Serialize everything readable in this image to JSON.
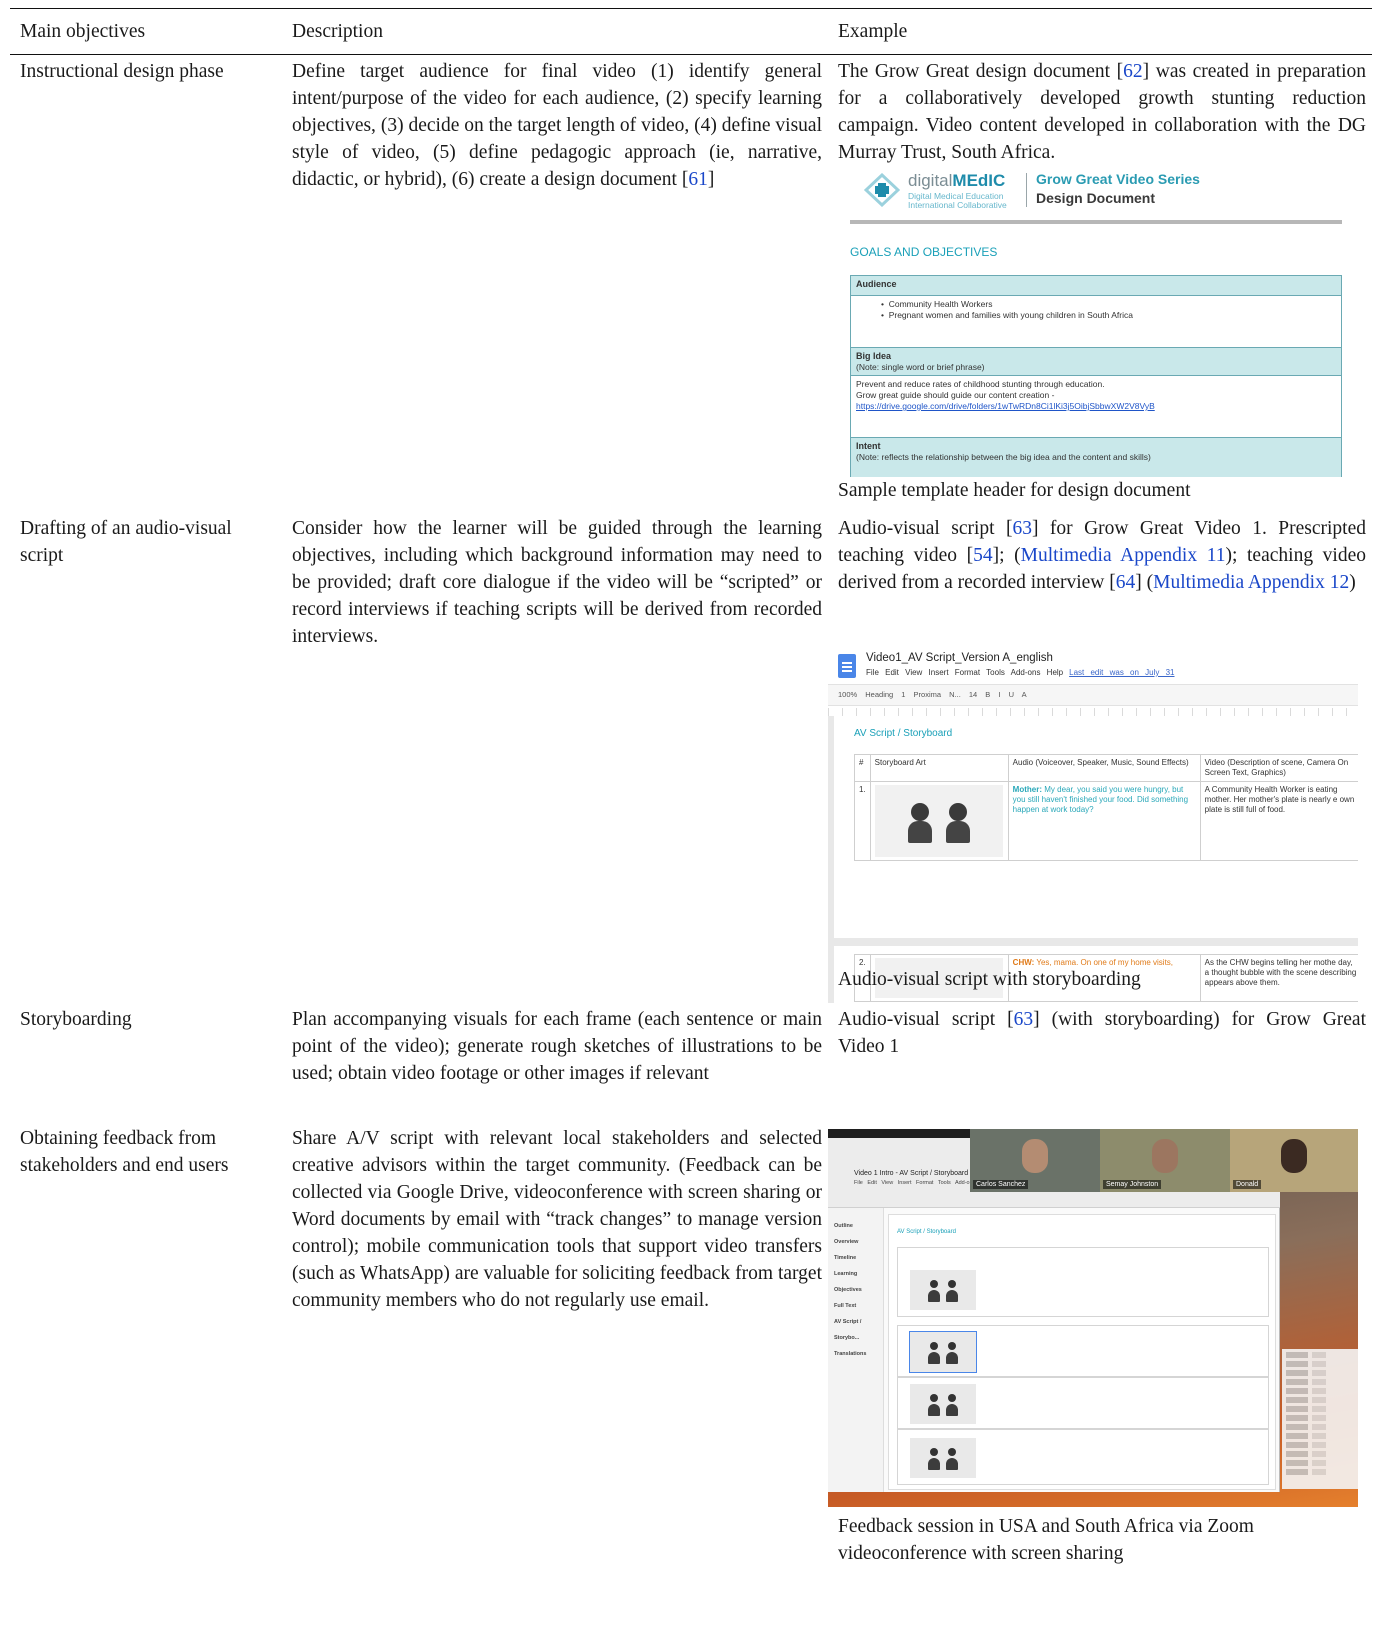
{
  "headers": {
    "col1": "Main objectives",
    "col2": "Description",
    "col3": "Example"
  },
  "rows": [
    {
      "objective": "Instructional design phase",
      "description_parts": [
        "Define target audience for final video (1) identify general intent/purpose of the video for each audience, (2) specify learning objectives, (3) decide on the target length of video, (4) define visual style of video, (5) define pedagogic approach (ie, narrative, didactic, or hybrid), (6) create a design document [",
        "61",
        "]"
      ],
      "example_parts": [
        "The Grow Great design document [",
        "62",
        "] was created in preparation for a collaboratively developed growth stunting reduction campaign. Video content developed in collaboration with the DG Murray Trust, South Africa."
      ],
      "caption": "Sample template header for design document"
    },
    {
      "objective": "Drafting of an audio-visual script",
      "description": "Consider how the learner will be guided through the learning objectives, including which background information may need to be provided; draft core dialogue if the video will be “scripted” or record interviews if teaching scripts will be derived from recorded interviews.",
      "example_parts": [
        "Audio-visual script [",
        "63",
        "] for Grow Great Video 1. Prescripted teaching video [",
        "54",
        "]; (",
        "Multimedia Appendix 11",
        "); teaching video derived from a recorded interview [",
        "64",
        "] (",
        "Multimedia Appendix 12",
        ")"
      ],
      "caption": "Audio-visual script with storyboarding"
    },
    {
      "objective": "Storyboarding",
      "description": "Plan accompanying visuals for each frame (each sentence or main point of the video); generate rough sketches of illustrations to be used; obtain video footage or other images if relevant",
      "example_parts": [
        "Audio-visual script [",
        "63",
        "] (with storyboarding) for Grow Great Video 1"
      ]
    },
    {
      "objective": "Obtaining feedback from stakeholders and end users",
      "description": "Share A/V script with relevant local stakeholders and selected creative advisors within the target community. (Feedback can be collected via Google Drive, videoconference with screen sharing or Word documents by email with “track changes” to manage version control); mobile communication tools that support video transfers (such as WhatsApp) are valuable for soliciting feedback from target community members who do not regularly use email.",
      "caption": "Feedback session in USA and South Africa via Zoom videoconference with screen sharing"
    }
  ],
  "figure_design_doc": {
    "brand_prefix": "digital",
    "brand_bold": "MEdIC",
    "brand_sub1": "Digital Medical Education",
    "brand_sub2": "International Collaborative",
    "series": "Grow Great Video Series",
    "doc": "Design Document",
    "goals": "GOALS AND OBJECTIVES",
    "audience": "Audience",
    "audience_items": [
      "Community Health Workers",
      "Pregnant women and families with young children in South Africa"
    ],
    "big_idea": "Big Idea",
    "big_idea_note": "(Note: single word or brief phrase)",
    "big_idea_text1": "Prevent and reduce rates of childhood stunting through education.",
    "big_idea_text2": "Grow great guide should guide our content creation  -",
    "big_idea_link": "https://drive.google.com/drive/folders/1wTwRDn8Ci1lKi3j5OibjSbbwXW2V8VyB",
    "intent": "Intent",
    "intent_note": "(Note: reflects the relationship between the big idea and the content and skills)"
  },
  "figure_av_script": {
    "doc_title": "Video1_AV Script_Version A_english",
    "menu": "File  Edit  View  Insert  Format  Tools  Add-ons  Help",
    "last_edit": "Last edit was on July 31",
    "toolbar": "100%  Heading 1  Proxima N...  14  B  I  U  A",
    "heading": "AV Script / Storyboard",
    "col_num": "#",
    "col_art": "Storyboard Art",
    "col_audio": "Audio (Voiceover, Speaker, Music, Sound Effects)",
    "col_video": "Video (Description of scene, Camera On Screen Text, Graphics)",
    "row1_num": "1.",
    "row1_speaker": "Mother:",
    "row1_audio": "My dear, you said you were hungry, but you still haven't finished your food. Did something happen at work today?",
    "row1_video": "A Community Health Worker is eating mother. Her mother's plate is nearly e own plate is still full of food.",
    "row2_num": "2.",
    "row2_speaker": "CHW:",
    "row2_audio": "Yes, mama. On one of my home visits,",
    "row2_video": "As the CHW begins telling her mothe day, a thought bubble with the scene describing appears above them."
  },
  "figure_zoom": {
    "doc_title": "Video 1 Intro - AV Script / Storyboard",
    "menu": "File  Edit  View  Insert  Format  Tools  Add-ons",
    "outline_items": [
      "Outline",
      "Overview",
      "Timeline",
      "Learning Objectives",
      "Full Text",
      "AV Script / Storybo...",
      "Translations"
    ],
    "heading": "AV Script / Storyboard",
    "participants": [
      "Carlos Sanchez",
      "Semay Johnston",
      "Donald"
    ]
  }
}
